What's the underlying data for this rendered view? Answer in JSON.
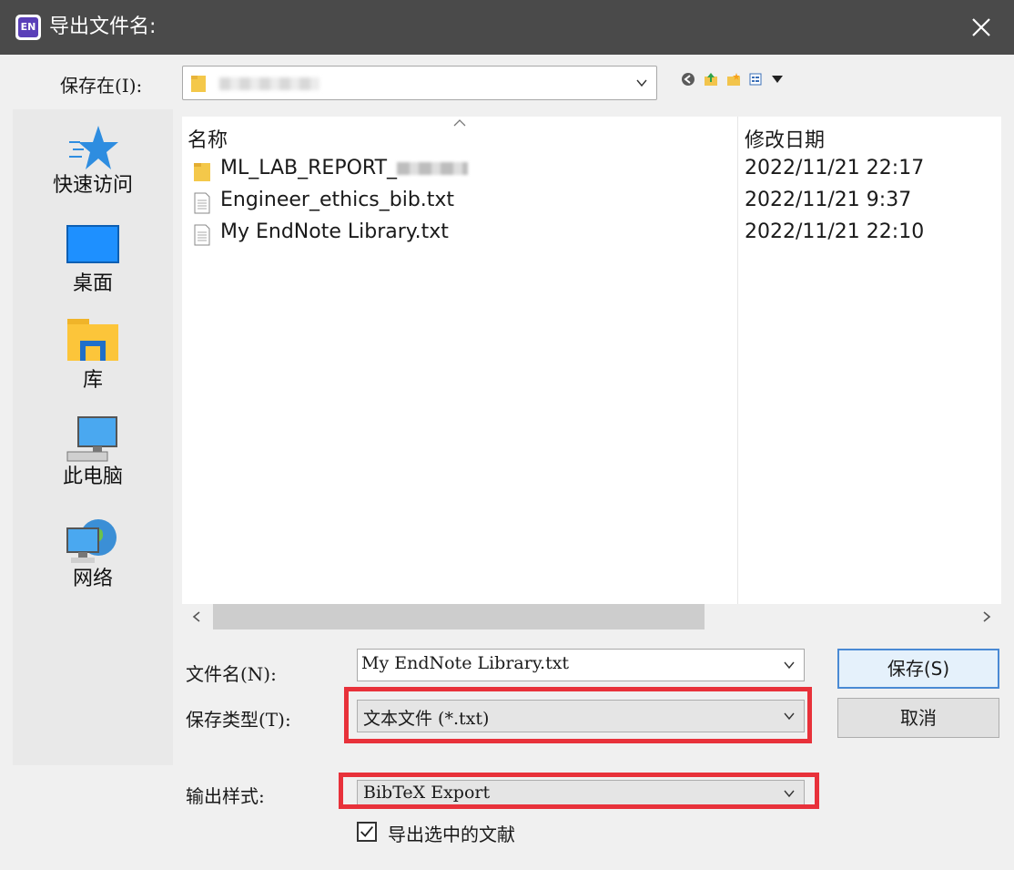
{
  "window": {
    "title": "导出文件名:",
    "app_icon_text": "EN"
  },
  "save_in": {
    "label": "保存在(I):",
    "value": ""
  },
  "toolbar": {
    "icons": [
      "back-icon",
      "up-folder-icon",
      "new-folder-icon",
      "view-menu-icon"
    ]
  },
  "places": [
    {
      "label": "快速访问",
      "icon": "star-icon"
    },
    {
      "label": "桌面",
      "icon": "desktop-icon"
    },
    {
      "label": "库",
      "icon": "library-icon"
    },
    {
      "label": "此电脑",
      "icon": "computer-icon"
    },
    {
      "label": "网络",
      "icon": "network-icon"
    }
  ],
  "file_list": {
    "columns": [
      "名称",
      "修改日期"
    ],
    "rows": [
      {
        "name": "ML_LAB_REPORT_",
        "date": "2022/11/21 22:17",
        "type": "folder"
      },
      {
        "name": "Engineer_ethics_bib.txt",
        "date": "2022/11/21 9:37",
        "type": "file"
      },
      {
        "name": "My EndNote Library.txt",
        "date": "2022/11/21 22:10",
        "type": "file"
      }
    ]
  },
  "form": {
    "filename_label": "文件名(N):",
    "filename_value": "My EndNote Library.txt",
    "filetype_label": "保存类型(T):",
    "filetype_value": "文本文件 (*.txt)",
    "output_style_label": "输出样式:",
    "output_style_value": "BibTeX Export",
    "export_selected_label": "导出选中的文献",
    "export_selected_checked": true
  },
  "buttons": {
    "save": "保存(S)",
    "cancel": "取消"
  },
  "colors": {
    "titlebar": "#4a4a4a",
    "highlight": "#e8313a",
    "accent": "#4a8ad4"
  }
}
